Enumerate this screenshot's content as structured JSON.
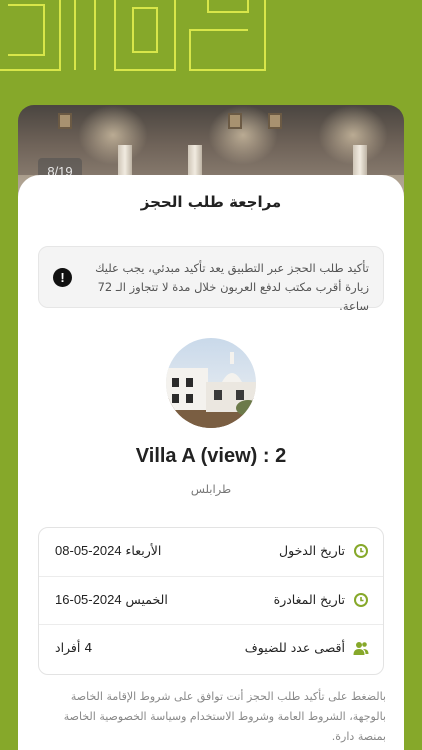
{
  "gallery": {
    "counter": "8/19"
  },
  "review": {
    "title": "مراجعة طلب الحجز",
    "notice": "تأكيد طلب الحجز عبر التطبيق يعد تأكيد مبدئي، يجب عليك زيارة أقرب مكتب لدفع العربون خلال مدة لا تتجاوز الـ 72 ساعة.",
    "notice_icon": "exclamation-icon"
  },
  "property": {
    "name": "Villa A (view) : 2",
    "city": "طرابلس"
  },
  "details": [
    {
      "label": "تاريخ الدخول",
      "day": "الأربعاء",
      "date": "2024-05-08",
      "icon": "clock-icon"
    },
    {
      "label": "تاريخ المغادرة",
      "day": "الخميس",
      "date": "2024-05-16",
      "icon": "clock-icon"
    },
    {
      "label": "أقصى عدد للضيوف",
      "value": "4 أفراد",
      "icon": "users-icon"
    }
  ],
  "terms": "بالضغط على تأكيد طلب الحجز أنت توافق على شروط الإقامة الخاصة بالوجهة، الشروط العامة وشروط الاستخدام وسياسة الخصوصية الخاصة بمنصة دارة.",
  "colors": {
    "background": "#86a82a",
    "accent": "#86a82a",
    "sheet": "#ffffff"
  }
}
